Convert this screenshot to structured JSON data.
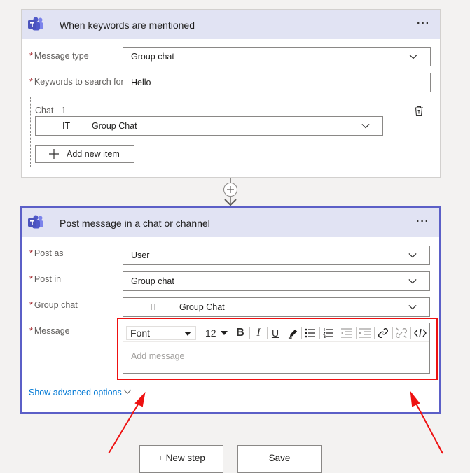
{
  "trigger": {
    "title": "When keywords are mentioned",
    "more": "···",
    "fields": {
      "message_type": {
        "label": "Message type",
        "value": "Group chat"
      },
      "keywords": {
        "label": "Keywords to search for",
        "value": "Hello"
      }
    },
    "chat_group": {
      "label": "Chat - 1",
      "item": {
        "prefix": "IT",
        "value": "Group Chat"
      },
      "add_button": "Add new item"
    }
  },
  "action": {
    "title": "Post message in a chat or channel",
    "more": "···",
    "fields": {
      "post_as": {
        "label": "Post as",
        "value": "User"
      },
      "post_in": {
        "label": "Post in",
        "value": "Group chat"
      },
      "group_chat": {
        "label": "Group chat",
        "prefix": "IT",
        "value": "Group Chat"
      },
      "message": {
        "label": "Message",
        "placeholder": "Add message"
      }
    },
    "toolbar": {
      "font": "Font",
      "size": "12",
      "bold": "B",
      "italic": "I",
      "underline": "U"
    },
    "advanced": "Show advanced options"
  },
  "footer": {
    "new_step": "+ New step",
    "save": "Save"
  },
  "colors": {
    "accent": "#5b5fc7",
    "header_bg": "#e1e3f3",
    "annotation": "#e11",
    "required": "#a4262c"
  },
  "icons": [
    "teams-logo",
    "more-icon",
    "chevron-down-icon",
    "delete-icon",
    "plus-icon",
    "bold-icon",
    "italic-icon",
    "underline-icon",
    "highlight-icon",
    "bullet-list-icon",
    "numbered-list-icon",
    "outdent-icon",
    "indent-icon",
    "link-icon",
    "unlink-icon",
    "code-view-icon"
  ]
}
